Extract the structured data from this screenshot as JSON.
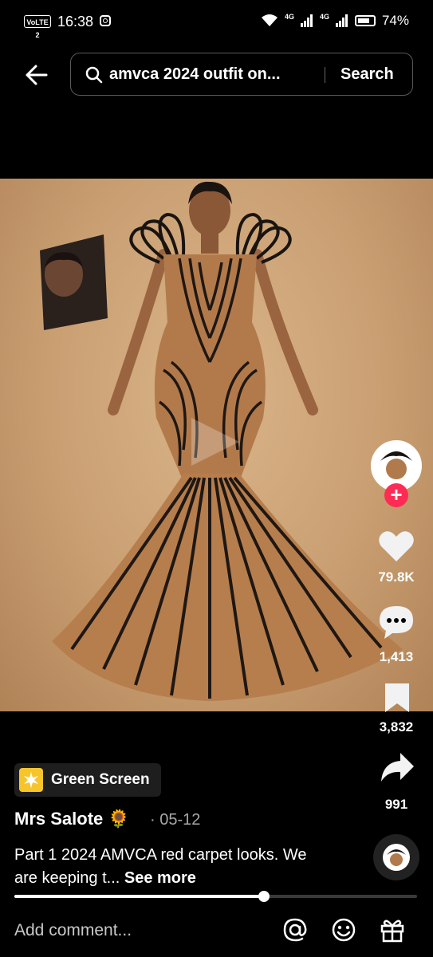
{
  "status_bar": {
    "volte": "VoLTE 2",
    "time": "16:38",
    "network_1": "4G",
    "network_2": "4G",
    "battery": "74%"
  },
  "search": {
    "query": "amvca 2024 outfit on...",
    "button": "Search"
  },
  "video": {
    "subject": "model-in-mermaid-gown"
  },
  "rail": {
    "likes": "79.8K",
    "comments": "1,413",
    "saves": "3,832",
    "shares": "991"
  },
  "effect": {
    "label": "Green Screen"
  },
  "post": {
    "author": "Mrs Salote 🌻",
    "date": "· 05-12",
    "caption": "Part 1 2024 AMVCA red carpet looks. We are keeping t...",
    "see_more": "See more",
    "progress": 0.62
  },
  "comment": {
    "placeholder": "Add comment..."
  },
  "colors": {
    "accent": "#fe2c55",
    "background": "#000000",
    "effect_icon": "#f7c52b"
  }
}
